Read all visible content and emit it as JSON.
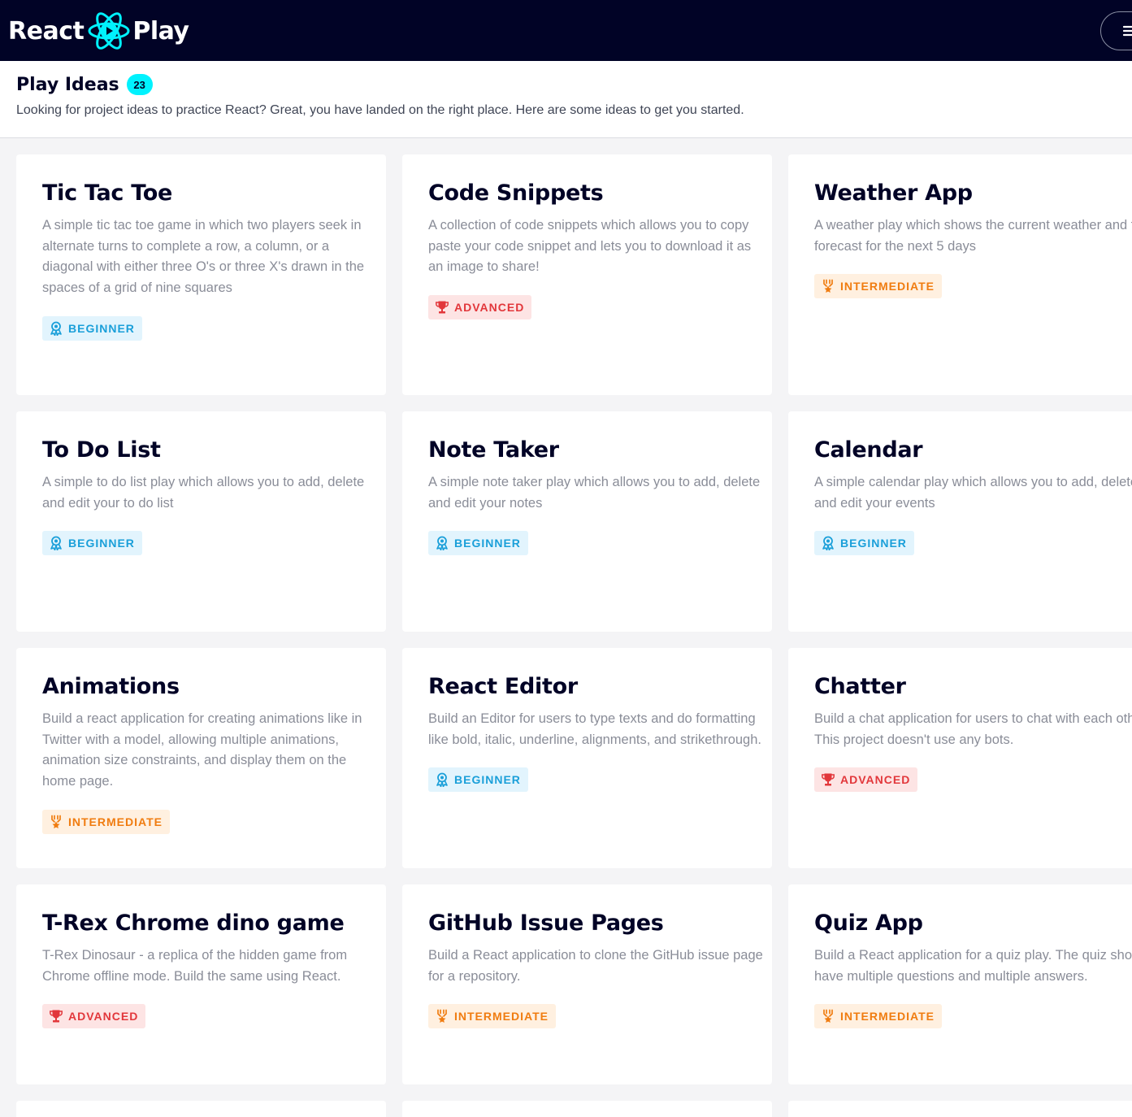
{
  "brand": {
    "text_left": "React",
    "text_right": "Play"
  },
  "header": {
    "title": "Play Ideas",
    "count": "23",
    "subtitle": "Looking for project ideas to practice React? Great, you have landed on the right place. Here are some ideas to get you started."
  },
  "levels": {
    "beginner": "BEGINNER",
    "intermediate": "INTERMEDIATE",
    "advanced": "ADVANCED"
  },
  "ideas": [
    {
      "title": "Tic Tac Toe",
      "description": "A simple tic tac toe game in which two players seek in alternate turns to complete a row, a column, or a diagonal with either three O's or three X's drawn in the spaces of a grid of nine squares",
      "level": "BEGINNER"
    },
    {
      "title": "Code Snippets",
      "description": "A collection of code snippets which allows you to copy paste your code snippet and lets you to download it as an image to share!",
      "level": "ADVANCED"
    },
    {
      "title": "Weather App",
      "description": "A weather play which shows the current weather and the forecast for the next 5 days",
      "level": "INTERMEDIATE"
    },
    {
      "title": "To Do List",
      "description": "A simple to do list play which allows you to add, delete and edit your to do list",
      "level": "BEGINNER"
    },
    {
      "title": "Note Taker",
      "description": "A simple note taker play which allows you to add, delete and edit your notes",
      "level": "BEGINNER"
    },
    {
      "title": "Calendar",
      "description": "A simple calendar play which allows you to add, delete and edit your events",
      "level": "BEGINNER"
    },
    {
      "title": "Animations",
      "description": "Build a react application for creating animations like in Twitter with a model, allowing multiple animations, animation size constraints, and display them on the home page.",
      "level": "INTERMEDIATE"
    },
    {
      "title": "React Editor",
      "description": "Build an Editor for users to type texts and do formatting like bold, italic, underline, alignments, and strikethrough.",
      "level": "BEGINNER"
    },
    {
      "title": "Chatter",
      "description": "Build a chat application for users to chat with each other. This project doesn't use any bots.",
      "level": "ADVANCED"
    },
    {
      "title": "T-Rex Chrome dino game",
      "description": "T-Rex Dinosaur - a replica of the hidden game from Chrome offline mode. Build the same using React.",
      "level": "ADVANCED"
    },
    {
      "title": "GitHub Issue Pages",
      "description": "Build a React application to clone the GitHub issue page for a repository.",
      "level": "INTERMEDIATE"
    },
    {
      "title": "Quiz App",
      "description": "Build a React application for a quiz play. The quiz should have multiple questions and multiple answers.",
      "level": "INTERMEDIATE"
    }
  ],
  "colors": {
    "topbar": "#010326",
    "accent": "#00f2fe",
    "beginner": "#1a9fd9",
    "intermediate": "#f07c10",
    "advanced": "#e2373b"
  },
  "icons": {
    "menu": "menu-icon",
    "logo": "react-play-logo-icon",
    "beginner": "award-ribbon-icon",
    "intermediate": "medal-icon",
    "advanced": "trophy-icon"
  }
}
